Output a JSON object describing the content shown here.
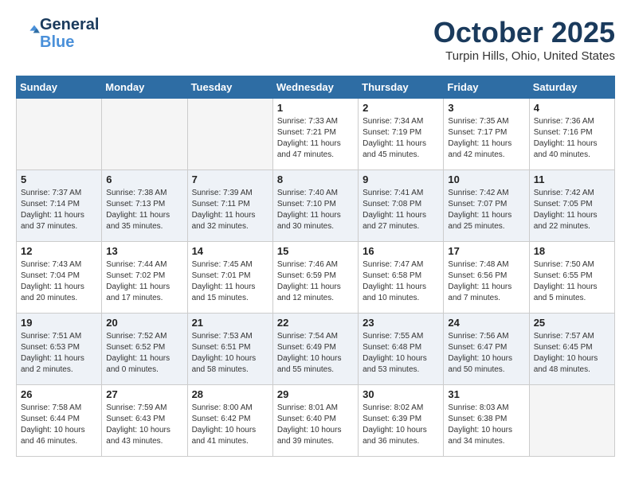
{
  "header": {
    "logo_line1": "General",
    "logo_line2": "Blue",
    "month": "October 2025",
    "location": "Turpin Hills, Ohio, United States"
  },
  "weekdays": [
    "Sunday",
    "Monday",
    "Tuesday",
    "Wednesday",
    "Thursday",
    "Friday",
    "Saturday"
  ],
  "weeks": [
    [
      {
        "num": "",
        "info": ""
      },
      {
        "num": "",
        "info": ""
      },
      {
        "num": "",
        "info": ""
      },
      {
        "num": "1",
        "info": "Sunrise: 7:33 AM\nSunset: 7:21 PM\nDaylight: 11 hours\nand 47 minutes."
      },
      {
        "num": "2",
        "info": "Sunrise: 7:34 AM\nSunset: 7:19 PM\nDaylight: 11 hours\nand 45 minutes."
      },
      {
        "num": "3",
        "info": "Sunrise: 7:35 AM\nSunset: 7:17 PM\nDaylight: 11 hours\nand 42 minutes."
      },
      {
        "num": "4",
        "info": "Sunrise: 7:36 AM\nSunset: 7:16 PM\nDaylight: 11 hours\nand 40 minutes."
      }
    ],
    [
      {
        "num": "5",
        "info": "Sunrise: 7:37 AM\nSunset: 7:14 PM\nDaylight: 11 hours\nand 37 minutes."
      },
      {
        "num": "6",
        "info": "Sunrise: 7:38 AM\nSunset: 7:13 PM\nDaylight: 11 hours\nand 35 minutes."
      },
      {
        "num": "7",
        "info": "Sunrise: 7:39 AM\nSunset: 7:11 PM\nDaylight: 11 hours\nand 32 minutes."
      },
      {
        "num": "8",
        "info": "Sunrise: 7:40 AM\nSunset: 7:10 PM\nDaylight: 11 hours\nand 30 minutes."
      },
      {
        "num": "9",
        "info": "Sunrise: 7:41 AM\nSunset: 7:08 PM\nDaylight: 11 hours\nand 27 minutes."
      },
      {
        "num": "10",
        "info": "Sunrise: 7:42 AM\nSunset: 7:07 PM\nDaylight: 11 hours\nand 25 minutes."
      },
      {
        "num": "11",
        "info": "Sunrise: 7:42 AM\nSunset: 7:05 PM\nDaylight: 11 hours\nand 22 minutes."
      }
    ],
    [
      {
        "num": "12",
        "info": "Sunrise: 7:43 AM\nSunset: 7:04 PM\nDaylight: 11 hours\nand 20 minutes."
      },
      {
        "num": "13",
        "info": "Sunrise: 7:44 AM\nSunset: 7:02 PM\nDaylight: 11 hours\nand 17 minutes."
      },
      {
        "num": "14",
        "info": "Sunrise: 7:45 AM\nSunset: 7:01 PM\nDaylight: 11 hours\nand 15 minutes."
      },
      {
        "num": "15",
        "info": "Sunrise: 7:46 AM\nSunset: 6:59 PM\nDaylight: 11 hours\nand 12 minutes."
      },
      {
        "num": "16",
        "info": "Sunrise: 7:47 AM\nSunset: 6:58 PM\nDaylight: 11 hours\nand 10 minutes."
      },
      {
        "num": "17",
        "info": "Sunrise: 7:48 AM\nSunset: 6:56 PM\nDaylight: 11 hours\nand 7 minutes."
      },
      {
        "num": "18",
        "info": "Sunrise: 7:50 AM\nSunset: 6:55 PM\nDaylight: 11 hours\nand 5 minutes."
      }
    ],
    [
      {
        "num": "19",
        "info": "Sunrise: 7:51 AM\nSunset: 6:53 PM\nDaylight: 11 hours\nand 2 minutes."
      },
      {
        "num": "20",
        "info": "Sunrise: 7:52 AM\nSunset: 6:52 PM\nDaylight: 11 hours\nand 0 minutes."
      },
      {
        "num": "21",
        "info": "Sunrise: 7:53 AM\nSunset: 6:51 PM\nDaylight: 10 hours\nand 58 minutes."
      },
      {
        "num": "22",
        "info": "Sunrise: 7:54 AM\nSunset: 6:49 PM\nDaylight: 10 hours\nand 55 minutes."
      },
      {
        "num": "23",
        "info": "Sunrise: 7:55 AM\nSunset: 6:48 PM\nDaylight: 10 hours\nand 53 minutes."
      },
      {
        "num": "24",
        "info": "Sunrise: 7:56 AM\nSunset: 6:47 PM\nDaylight: 10 hours\nand 50 minutes."
      },
      {
        "num": "25",
        "info": "Sunrise: 7:57 AM\nSunset: 6:45 PM\nDaylight: 10 hours\nand 48 minutes."
      }
    ],
    [
      {
        "num": "26",
        "info": "Sunrise: 7:58 AM\nSunset: 6:44 PM\nDaylight: 10 hours\nand 46 minutes."
      },
      {
        "num": "27",
        "info": "Sunrise: 7:59 AM\nSunset: 6:43 PM\nDaylight: 10 hours\nand 43 minutes."
      },
      {
        "num": "28",
        "info": "Sunrise: 8:00 AM\nSunset: 6:42 PM\nDaylight: 10 hours\nand 41 minutes."
      },
      {
        "num": "29",
        "info": "Sunrise: 8:01 AM\nSunset: 6:40 PM\nDaylight: 10 hours\nand 39 minutes."
      },
      {
        "num": "30",
        "info": "Sunrise: 8:02 AM\nSunset: 6:39 PM\nDaylight: 10 hours\nand 36 minutes."
      },
      {
        "num": "31",
        "info": "Sunrise: 8:03 AM\nSunset: 6:38 PM\nDaylight: 10 hours\nand 34 minutes."
      },
      {
        "num": "",
        "info": ""
      }
    ]
  ]
}
